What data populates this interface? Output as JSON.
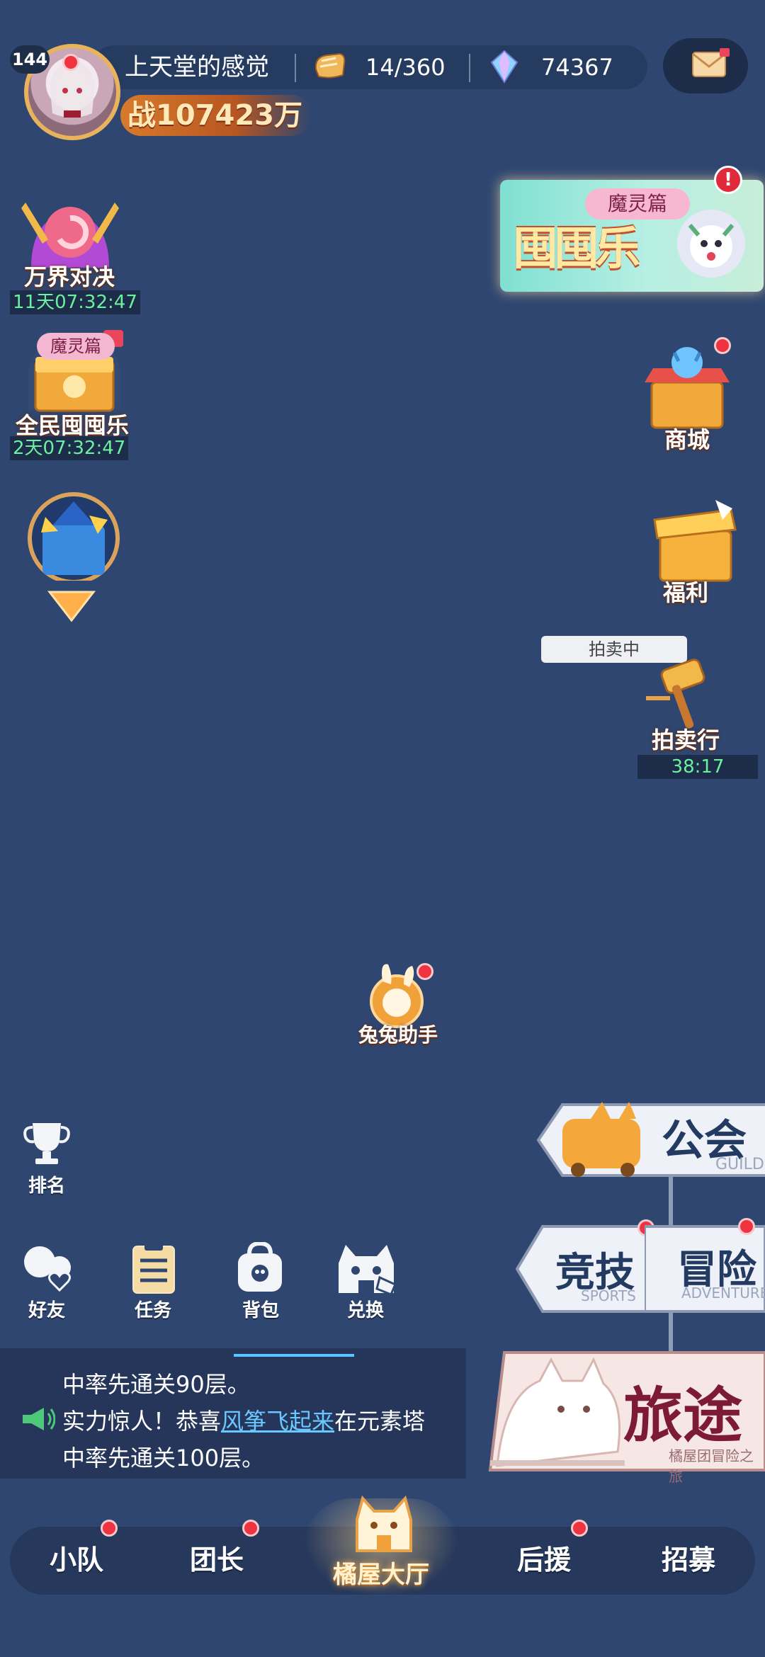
{
  "player": {
    "level": "144",
    "nickname": "上天堂的感觉",
    "stamina": "14/360",
    "gems": "74367",
    "power": "战107423万"
  },
  "events_left": [
    {
      "label": "万界对决",
      "timer": "11天07:32:47"
    },
    {
      "label": "全民囤囤乐",
      "tag": "魔灵篇",
      "timer": "2天07:32:47"
    }
  ],
  "banner": {
    "title": "囤囤乐",
    "tag": "魔灵篇",
    "alert": "!"
  },
  "right_column": {
    "shop": "商城",
    "welfare": "福利",
    "auction_status": "拍卖中",
    "auction": "拍卖行",
    "auction_timer": "38:17"
  },
  "helper": "兔兔助手",
  "side_buttons": {
    "rank": "排名",
    "friends": "好友",
    "tasks": "任务",
    "bag": "背包",
    "exchange": "兑换"
  },
  "chat": {
    "line1": "中率先通关90层。",
    "line2_prefix": "实力惊人！恭喜",
    "line2_name": "风筝飞起来",
    "line2_suffix": "在元素塔",
    "line3": "中率先通关100层。"
  },
  "modes": {
    "guild": "公会",
    "guild_sub": "GUILD",
    "sports": "竞技",
    "sports_sub": "SPORTS",
    "adventure": "冒险",
    "adventure_sub": "ADVENTURE",
    "journey": "旅途",
    "journey_sub": "橘屋团冒险之旅"
  },
  "nav": {
    "squad": "小队",
    "leader": "团长",
    "home": "橘屋大厅",
    "support": "后援",
    "recruit": "招募"
  },
  "colors": {
    "background": "#2e4670",
    "red_dot": "#ef3340",
    "timer_text": "#6bf0a1",
    "chat_highlight": "#69c8ff"
  }
}
